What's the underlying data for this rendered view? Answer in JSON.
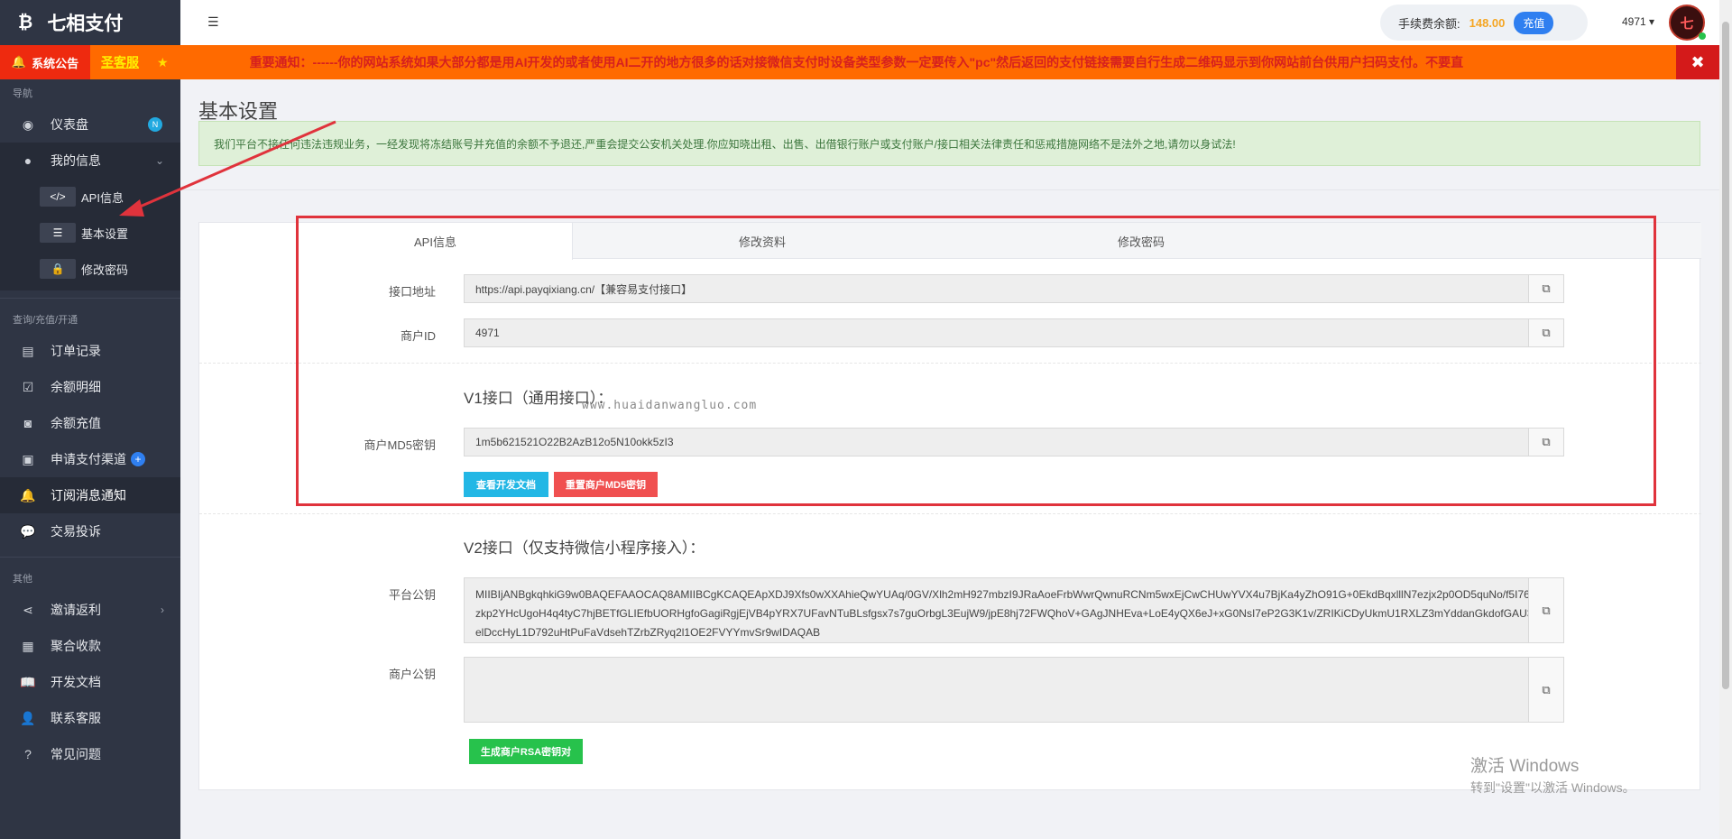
{
  "brand": {
    "logo": "₿",
    "name": "七相支付"
  },
  "sidebar": {
    "section_nav": "导航",
    "dashboard": {
      "label": "仪表盘",
      "badge": "N",
      "icon": "dashboard-icon"
    },
    "my_info": {
      "label": "我的信息",
      "icon": "user-icon"
    },
    "sub_items": [
      {
        "label": "API信息",
        "icon_glyph": "</>",
        "icon": "code-icon"
      },
      {
        "label": "基本设置",
        "icon_glyph": "☰",
        "icon": "sliders-icon"
      },
      {
        "label": "修改密码",
        "icon_glyph": "🔒",
        "icon": "lock-icon"
      }
    ],
    "section_query": "查询/充值/开通",
    "query_items": [
      {
        "label": "订单记录",
        "icon": "list-icon",
        "glyph": "▤"
      },
      {
        "label": "余额明细",
        "icon": "calendar-check-icon",
        "glyph": "☑"
      },
      {
        "label": "余额充值",
        "icon": "money-icon",
        "glyph": "◙"
      },
      {
        "label": "申请支付渠道",
        "icon": "id-card-icon",
        "glyph": "▣",
        "badge": "+"
      },
      {
        "label": "订阅消息通知",
        "icon": "bell-icon",
        "glyph": "🔔"
      },
      {
        "label": "交易投诉",
        "icon": "comments-icon",
        "glyph": "💬"
      }
    ],
    "section_other": "其他",
    "other_items": [
      {
        "label": "邀请返利",
        "icon": "share-icon",
        "glyph": "⋖"
      },
      {
        "label": "聚合收款",
        "icon": "qrcode-icon",
        "glyph": "▦"
      },
      {
        "label": "开发文档",
        "icon": "book-icon",
        "glyph": "📖"
      },
      {
        "label": "联系客服",
        "icon": "support-icon",
        "glyph": "👤"
      },
      {
        "label": "常见问题",
        "icon": "question-icon",
        "glyph": "?"
      }
    ]
  },
  "topbar": {
    "fee_label": "手续费余额:",
    "fee_amount": "148.00",
    "recharge_label": "充值",
    "user_id": "4971 ▾",
    "avatar_text": "七"
  },
  "notice": {
    "tag": "系统公告",
    "service": "圣客服",
    "text": "重要通知：------你的网站系统如果大部分都是用AI开发的或者使用AI二开的地方很多的话对接微信支付时设备类型参数一定要传入\"pc\"然后返回的支付链接需要自行生成二维码显示到你网站前台供用户扫码支付。不要直"
  },
  "page": {
    "title": "基本设置",
    "alert": "我们平台不接任何违法违规业务，一经发现将冻结账号并充值的余额不予退还,严重会提交公安机关处理.你应知晓出租、出售、出借银行账户或支付账户/接口相关法律责任和惩戒措施网络不是法外之地,请勿以身试法!"
  },
  "tabs": [
    {
      "label": "API信息"
    },
    {
      "label": "修改资料"
    },
    {
      "label": "修改密码"
    }
  ],
  "api": {
    "endpoint_label": "接口地址",
    "endpoint_value": "https://api.payqixiang.cn/【兼容易支付接口】",
    "merchant_label": "商户ID",
    "merchant_value": "4971",
    "v1_title": "V1接口（通用接口）：",
    "md5_label": "商户MD5密钥",
    "md5_value": "1m5b621521O22B2AzB12o5N10okk5zI3",
    "docs_button": "查看开发文档",
    "reset_button": "重置商户MD5密钥",
    "v2_title": "V2接口（仅支持微信小程序接入）：",
    "platform_key_label": "平台公钥",
    "platform_key_value": "MIIBIjANBgkqhkiG9w0BAQEFAAOCAQ8AMIIBCgKCAQEApXDJ9Xfs0wXXAhieQwYUAq/0GV/Xlh2mH927mbzI9JRaAoeFrbWwrQwnuRCNm5wxEjCwCHUwYVX4u7BjKa4yZhO91G+0EkdBqxlllN7ezjx2p0OD5quNo/f5I76zkp2YHcUgoH4q4tyC7hjBETfGLIEfbUORHgfoGagiRgjEjVB4pYRX7UFavNTuBLsfgsx7s7guOrbgL3EujW9/jpE8hj72FWQhoV+GAgJNHEva+LoE4yQX6eJ+xG0NsI7eP2G3K1v/ZRIKiCDyUkmU1RXLZ3mYddanGkdofGAU3elDccHyL1D792uHtPuFaVdsehTZrbZRyq2l1OE2FVYYmvSr9wIDAQAB",
    "merchant_key_label": "商户公钥",
    "merchant_key_value": "",
    "rsa_button": "生成商户RSA密钥对"
  },
  "watermark": "www.huaidanwangluo.com",
  "windows_activation": {
    "title": "激活 Windows",
    "subtitle": "转到\"设置\"以激活 Windows。"
  }
}
